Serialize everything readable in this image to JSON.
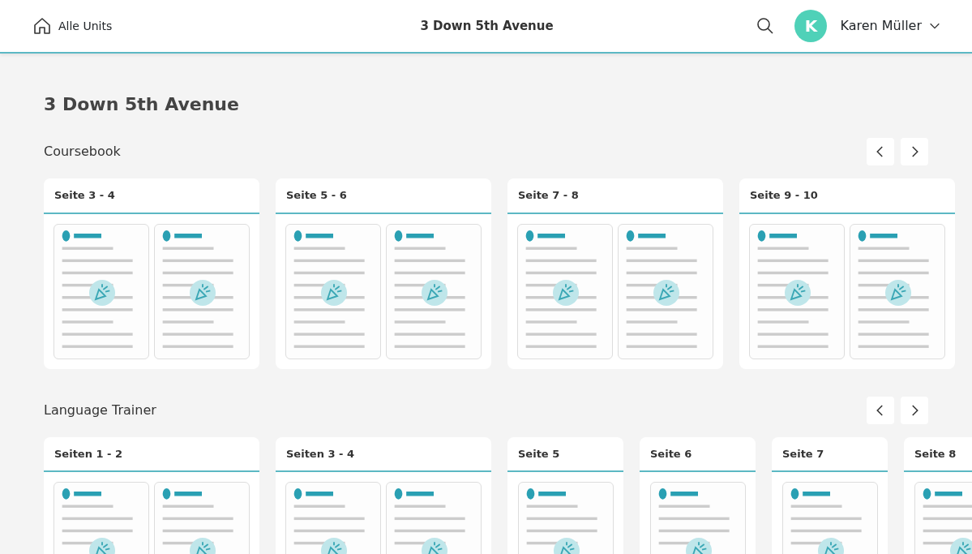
{
  "header": {
    "back_label": "Alle Units",
    "title": "3 Down 5th Avenue",
    "user": {
      "initial": "K",
      "name": "Karen Müller"
    }
  },
  "page_title": "3 Down 5th Avenue",
  "sections": [
    {
      "title": "Coursebook",
      "cards": [
        {
          "title": "Seite 3 - 4",
          "kind": "spread"
        },
        {
          "title": "Seite 5 - 6",
          "kind": "spread"
        },
        {
          "title": "Seite 7 - 8",
          "kind": "spread"
        },
        {
          "title": "Seite 9 - 10",
          "kind": "spread"
        }
      ]
    },
    {
      "title": "Language Trainer",
      "cards": [
        {
          "title": "Seiten 1 - 2",
          "kind": "spread"
        },
        {
          "title": "Seiten 3 - 4",
          "kind": "spread"
        },
        {
          "title": "Seite 5",
          "kind": "single"
        },
        {
          "title": "Seite 6",
          "kind": "single"
        },
        {
          "title": "Seite 7",
          "kind": "single"
        },
        {
          "title": "Seite 8",
          "kind": "single"
        }
      ]
    }
  ]
}
